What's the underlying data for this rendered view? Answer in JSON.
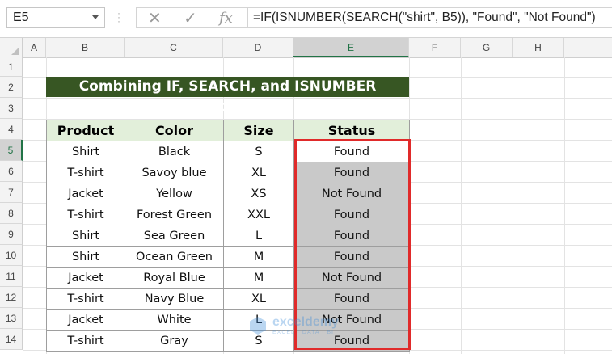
{
  "formula_bar": {
    "name_box": "E5",
    "cancel_icon": "✕",
    "enter_icon": "✓",
    "fx_label": "fx",
    "formula": "=IF(ISNUMBER(SEARCH(\"shirt\", B5)), \"Found\", \"Not Found\")"
  },
  "columns": [
    "A",
    "B",
    "C",
    "D",
    "E",
    "F",
    "G",
    "H"
  ],
  "rows": [
    "1",
    "2",
    "3",
    "4",
    "5",
    "6",
    "7",
    "8",
    "9",
    "10",
    "11",
    "12",
    "13",
    "14"
  ],
  "active_cell": "E5",
  "title": "Combining IF, SEARCH, and ISNUMBER Functions",
  "table": {
    "headers": [
      "Product",
      "Color",
      "Size",
      "Status"
    ],
    "rows": [
      [
        "Shirt",
        "Black",
        "S",
        "Found"
      ],
      [
        "T-shirt",
        "Savoy blue",
        "XL",
        "Found"
      ],
      [
        "Jacket",
        "Yellow",
        "XS",
        "Not Found"
      ],
      [
        "T-shirt",
        "Forest Green",
        "XXL",
        "Found"
      ],
      [
        "Shirt",
        "Sea Green",
        "L",
        "Found"
      ],
      [
        "Shirt",
        "Ocean Green",
        "M",
        "Found"
      ],
      [
        "Jacket",
        "Royal Blue",
        "M",
        "Not Found"
      ],
      [
        "T-shirt",
        "Navy Blue",
        "XL",
        "Found"
      ],
      [
        "Jacket",
        "White",
        "L",
        "Not Found"
      ],
      [
        "T-shirt",
        "Gray",
        "S",
        "Found"
      ]
    ]
  },
  "watermark": {
    "name": "exceldemy",
    "tagline": "EXCEL · DATA · BI"
  },
  "colors": {
    "title_bg": "#375623",
    "header_bg": "#e2efda",
    "status_bg": "#c9c9c9",
    "highlight": "#e02a2a",
    "active_header": "#217346"
  }
}
